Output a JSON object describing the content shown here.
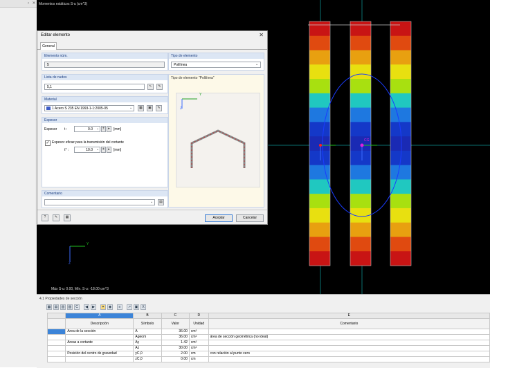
{
  "viewport": {
    "title": "Momentos estáticos S-u (cm^3)",
    "info": "Máx S-u: 0.00, Mín. S-u: -18.00 cm^3",
    "axes": {
      "x": "Y",
      "z": "Z"
    },
    "centroid_label": "CG"
  },
  "dialog": {
    "title": "Editar elemento",
    "tab": "General",
    "element_no": {
      "label": "Elemento núm.",
      "value": "5"
    },
    "element_type": {
      "label": "Tipo de elemento",
      "value": "Polilínea"
    },
    "nodes": {
      "label": "Lista de nudos",
      "value": "5,1"
    },
    "type_preview_title": "Tipo de elemento \"Polilínea\"",
    "material": {
      "label": "Material",
      "value": "1 Acero S 235 EN 1993-1-1:2005-05"
    },
    "thickness": {
      "label": "Espesor",
      "row_label": "Espesor",
      "symbol": "t :",
      "value": "0.0",
      "unit": "[mm]",
      "checkbox_label": "Espesor eficaz para la transmisión del cortante",
      "checked": true,
      "symbol2": "t* :",
      "value2": "10.0",
      "unit2": "[mm]"
    },
    "comment": {
      "label": "Comentario",
      "value": ""
    },
    "buttons": {
      "ok": "Aceptar",
      "cancel": "Cancelar"
    }
  },
  "table": {
    "title": "4.1 Propiedades de sección",
    "col_letters": [
      "A",
      "B",
      "C",
      "D",
      "E"
    ],
    "headers": [
      "Descripción",
      "Símbolo",
      "Valor",
      "Unidad",
      "Comentario"
    ],
    "rows": [
      {
        "desc": "Área de la sección",
        "sym": "A",
        "val": "36.00",
        "unit": "cm²",
        "comment": ""
      },
      {
        "desc": "",
        "sym": "Ageom",
        "val": "36.00",
        "unit": "cm²",
        "comment": "área de sección geométrica (no ideal)"
      },
      {
        "desc": "Áreas a cortante",
        "sym": "Ay",
        "val": "1.42",
        "unit": "cm²",
        "comment": ""
      },
      {
        "desc": "",
        "sym": "Az",
        "val": "30.00",
        "unit": "cm²",
        "comment": ""
      },
      {
        "desc": "Posición del centro de gravedad",
        "sym": "yC,0",
        "val": "2.00",
        "unit": "cm",
        "comment": "con relación al punto cero"
      },
      {
        "desc": "",
        "sym": "zC,0",
        "val": "0.00",
        "unit": "cm",
        "comment": ""
      }
    ]
  },
  "colors": {
    "bands": [
      "#c81414",
      "#e04a10",
      "#e8a010",
      "#e8e010",
      "#a8e010",
      "#20c8c0",
      "#1e78e0",
      "#1438c8",
      "#1a2ab4"
    ],
    "accent": "#3c84d8"
  }
}
